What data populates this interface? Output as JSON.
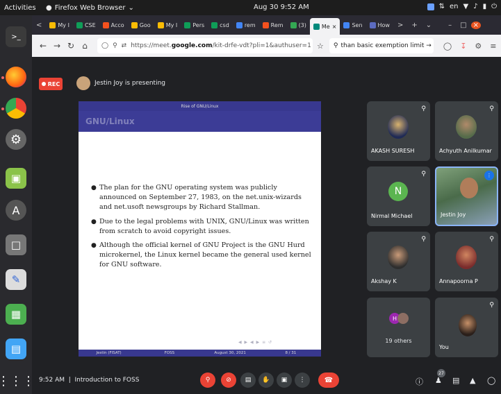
{
  "topbar": {
    "activities": "Activities",
    "app_name": "Firefox Web Browser",
    "datetime": "Aug 30  9:52 AM",
    "lang": "en"
  },
  "browser": {
    "tabs": [
      {
        "label": "My I",
        "color": "#fbbc04"
      },
      {
        "label": "CSE",
        "color": "#0f9d58"
      },
      {
        "label": "Acco",
        "color": "#f4511e"
      },
      {
        "label": "Goo",
        "color": "#fbbc04"
      },
      {
        "label": "My I",
        "color": "#fbbc04"
      },
      {
        "label": "Pers",
        "color": "#0f9d58"
      },
      {
        "label": "csd",
        "color": "#0f9d58"
      },
      {
        "label": "rem",
        "color": "#4285f4"
      },
      {
        "label": "Rem",
        "color": "#f4511e"
      },
      {
        "label": "(3)",
        "color": "#34a853"
      },
      {
        "label": "Me",
        "color": "#00897b",
        "active": true
      },
      {
        "label": "Sen",
        "color": "#4285f4"
      },
      {
        "label": "How",
        "color": "#5c6bc0"
      }
    ],
    "url_prefix": "https://meet.",
    "url_domain": "google.com",
    "url_path": "/kit-drfe-vdt?pli=1&authuser=1",
    "search_text": "than basic exemption limit →"
  },
  "meet": {
    "rec_label": "REC",
    "presenting_text": "Jestin Joy is presenting",
    "slide": {
      "header": "Rise of GNU/Linux",
      "title_faded": "GNU/Linux",
      "bullets": [
        "The plan for the GNU operating system was publicly announced on September 27, 1983, on the net.unix-wizards and net.usoft newsgroups by Richard Stallman.",
        "Due to the legal problems with UNIX, GNU/Linux was written from scratch to avoid copyright issues.",
        "Although the official kernel of GNU Project is the GNU Hurd microkernel, the Linux kernel became the general used kernel for GNU software."
      ],
      "footer": {
        "author": "Jestin (FISAT)",
        "course": "FOSS",
        "date": "August 30, 2021",
        "page": "8 / 31"
      }
    },
    "participants": [
      {
        "name": "AKASH SURESH"
      },
      {
        "name": "Achyuth Anilkumar"
      },
      {
        "name": "Nirmal Michael",
        "initial": "N"
      },
      {
        "name": "Jestin Joy"
      },
      {
        "name": "Akshay K"
      },
      {
        "name": "Annapoorna P"
      },
      {
        "name": "19 others",
        "initial": "H"
      },
      {
        "name": "You"
      }
    ],
    "time": "9:52 AM",
    "meeting_title": "Introduction to FOSS",
    "people_count": "27"
  }
}
